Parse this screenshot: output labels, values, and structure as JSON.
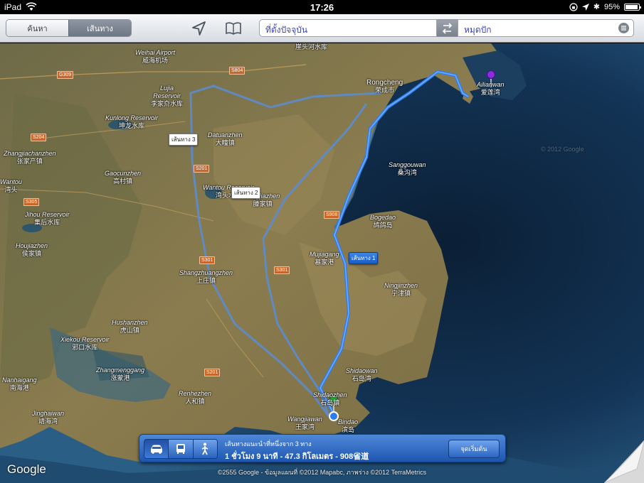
{
  "status_bar": {
    "device": "iPad",
    "time": "17:26",
    "battery": "95%",
    "battery_level": 0.95
  },
  "toolbar": {
    "segments": [
      {
        "label": "ค้นหา",
        "active": false
      },
      {
        "label": "เส้นทาง",
        "active": true
      }
    ],
    "location_icon": "location-arrow-icon",
    "bookmarks_icon": "book-icon",
    "start_field": "ที่ตั้งปัจจุบัน",
    "end_field": "หมุดปัก",
    "swap_icon": "swap-arrows-icon",
    "menu_icon": "list-menu-icon"
  },
  "map": {
    "roads": [
      "G309",
      "S804",
      "S204",
      "S305",
      "S201",
      "S301",
      "S908"
    ],
    "places": [
      {
        "name": "Weihai Airport",
        "cn": "威海机场"
      },
      {
        "name": "Lujia",
        "cn": "李家夼"
      },
      {
        "name": "Reservoir",
        "cn": "李家夼水库"
      },
      {
        "name": "",
        "cn": "崖头河水库"
      },
      {
        "name": "Rongcheng",
        "cn": "荣成市"
      },
      {
        "name": "Ailianwan",
        "cn": "爱莲湾"
      },
      {
        "name": "Kunlong Reservoir",
        "cn": "坤龙水库"
      },
      {
        "name": "Datuanzhen",
        "cn": "大疃镇"
      },
      {
        "name": "Zhangjiachanzhen",
        "cn": "张家产镇"
      },
      {
        "name": "Gaocunzhen",
        "cn": "高村镇"
      },
      {
        "name": "Sanggouwan",
        "cn": "桑沟湾"
      },
      {
        "name": "Wantou Reservoir",
        "cn": "湾头水库"
      },
      {
        "name": "Tengjiazhen",
        "cn": "滕家镇"
      },
      {
        "name": "Wantou",
        "cn": "湾头"
      },
      {
        "name": "Jihou Reservoir",
        "cn": "集后水库"
      },
      {
        "name": "Bogedao",
        "cn": "鸪鸽岛"
      },
      {
        "name": "Houjiazhen",
        "cn": "侯家镇"
      },
      {
        "name": "Mujiagang",
        "cn": "慕家港"
      },
      {
        "name": "Shangzhuangzhen",
        "cn": "上庄镇"
      },
      {
        "name": "Ningjinzhen",
        "cn": "宁津镇"
      },
      {
        "name": "Hushanzhen",
        "cn": "虎山镇"
      },
      {
        "name": "Xiekou Reservoir",
        "cn": "邪口水库"
      },
      {
        "name": "Zhangmenggang",
        "cn": "涨蒙港"
      },
      {
        "name": "Shidaowan",
        "cn": "石岛湾"
      },
      {
        "name": "Nanhaigang",
        "cn": "南海港"
      },
      {
        "name": "Renhezhen",
        "cn": "人和镇"
      },
      {
        "name": "Shidaozhen",
        "cn": "石岛镇"
      },
      {
        "name": "Jinghaiwan",
        "cn": "靖海湾"
      },
      {
        "name": "Wangjiawan",
        "cn": "王家湾"
      },
      {
        "name": "Bindao",
        "cn": "滨岛"
      }
    ],
    "route_tags": [
      {
        "label": "เส้นทาง 3",
        "primary": false
      },
      {
        "label": "เส้นทาง 2",
        "primary": false
      },
      {
        "label": "เส้นทาง 1",
        "primary": true
      }
    ],
    "watermark": "© 2012 Google",
    "logo": "Google",
    "copyright": "©2555 Google -  ข้อมูลแผนที่ ©2012 Mapabc, ภาพร่าง ©2012 TerraMetrics"
  },
  "directions_panel": {
    "modes": [
      {
        "icon": "car-icon",
        "active": true
      },
      {
        "icon": "bus-icon",
        "active": false
      },
      {
        "icon": "walk-icon",
        "active": false
      }
    ],
    "summary": "เส้นทางแนะนำที่หนึ่งจาก 3 ทาง",
    "detail": "1 ชั่วโมง 9 นาที - 47.3 กิโลเมตร - 908省道",
    "start_button": "จุดเริ่มต้น"
  },
  "colors": {
    "route_primary": "#2f7ef0",
    "route_alternate": "#6fa3e8",
    "pin_end": "#8d2be0",
    "pin_start": "#2cb33c"
  }
}
